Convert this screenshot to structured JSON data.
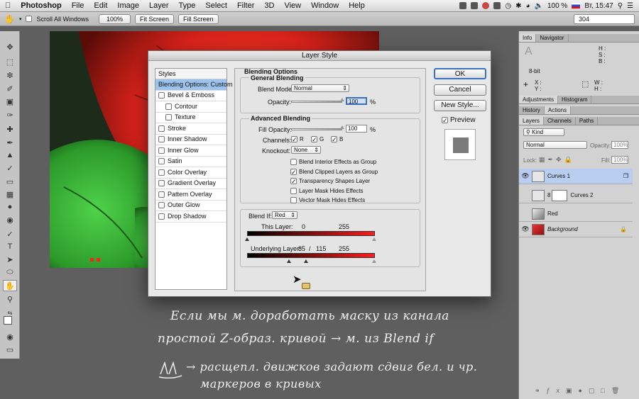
{
  "menubar": {
    "apple": "",
    "app": "Photoshop",
    "menus": [
      "File",
      "Edit",
      "Image",
      "Layer",
      "Type",
      "Select",
      "Filter",
      "3D",
      "View",
      "Window",
      "Help"
    ],
    "battery": "100 %",
    "clock": "Вт, 15:47"
  },
  "optionsbar": {
    "scroll_all_label": "Scroll All Windows",
    "zoom_label": "100%",
    "fit_label": "Fit Screen",
    "fill_label": "Fill Screen",
    "workspace_value": "304"
  },
  "panels": {
    "info_tabs": [
      "Info",
      "Navigator"
    ],
    "info": {
      "bitdepth": "8-bit",
      "h": "H :",
      "s": "S :",
      "b": "B :",
      "x": "X :",
      "y": "Y :",
      "w": "W :",
      "hh": "H :"
    },
    "adj_tabs": [
      "Adjustments",
      "Histogram"
    ],
    "hist_tabs": [
      "History",
      "Actions"
    ],
    "layer_tabs": [
      "Layers",
      "Channels",
      "Paths"
    ],
    "kind_label": "Kind",
    "blend_mode": "Normal",
    "opacity_label": "Opacity:",
    "opacity_value": "100%",
    "lock_label": "Lock:",
    "fill_label": "Fill:",
    "fill_value": "100%",
    "layers": [
      {
        "name": "Curves 1",
        "visible": true
      },
      {
        "name": "Curves 2",
        "visible": false
      },
      {
        "name": "Red",
        "visible": false
      },
      {
        "name": "Background",
        "visible": true
      }
    ]
  },
  "dialog": {
    "title": "Layer Style",
    "styles_header": "Styles",
    "styles": [
      {
        "label": "Blending Options: Custom",
        "selected": true,
        "indent": false,
        "check": false
      },
      {
        "label": "Bevel & Emboss",
        "indent": false,
        "check": true
      },
      {
        "label": "Contour",
        "indent": true,
        "check": true
      },
      {
        "label": "Texture",
        "indent": true,
        "check": true
      },
      {
        "label": "Stroke",
        "indent": false,
        "check": true
      },
      {
        "label": "Inner Shadow",
        "indent": false,
        "check": true
      },
      {
        "label": "Inner Glow",
        "indent": false,
        "check": true
      },
      {
        "label": "Satin",
        "indent": false,
        "check": true
      },
      {
        "label": "Color Overlay",
        "indent": false,
        "check": true
      },
      {
        "label": "Gradient Overlay",
        "indent": false,
        "check": true
      },
      {
        "label": "Pattern Overlay",
        "indent": false,
        "check": true
      },
      {
        "label": "Outer Glow",
        "indent": false,
        "check": true
      },
      {
        "label": "Drop Shadow",
        "indent": false,
        "check": true
      }
    ],
    "blending_options": "Blending Options",
    "general_blending": "General Blending",
    "blend_mode_label": "Blend Mode:",
    "blend_mode_value": "Normal",
    "opacity_label": "Opacity:",
    "opacity_value": "100",
    "percent": "%",
    "advanced_blending": "Advanced Blending",
    "fill_opacity_label": "Fill Opacity:",
    "fill_opacity_value": "100",
    "channels_label": "Channels:",
    "channels": [
      "R",
      "G",
      "B"
    ],
    "knockout_label": "Knockout:",
    "knockout_value": "None",
    "checks": [
      {
        "label": "Blend Interior Effects as Group",
        "checked": false
      },
      {
        "label": "Blend Clipped Layers as Group",
        "checked": true
      },
      {
        "label": "Transparency Shapes Layer",
        "checked": true
      },
      {
        "label": "Layer Mask Hides Effects",
        "checked": false
      },
      {
        "label": "Vector Mask Hides Effects",
        "checked": false
      }
    ],
    "blend_if_label": "Blend If:",
    "blend_if_value": "Red",
    "this_layer_label": "This Layer:",
    "this_layer_low": "0",
    "this_layer_high": "255",
    "underlying_label": "Underlying Layer:",
    "underlying_low": "85",
    "underlying_sep": "/",
    "underlying_mid": "115",
    "underlying_high": "255",
    "buttons": {
      "ok": "OK",
      "cancel": "Cancel",
      "new_style": "New Style..."
    },
    "preview_label": "Preview"
  },
  "handwriting": [
    "Если мы м. доработать маску из канала",
    "простой Z-образ. кривой → м. из Blend if",
    "→ расщепл. движков задают сдвиг бел. и чр.",
    "маркеров в кривых"
  ]
}
